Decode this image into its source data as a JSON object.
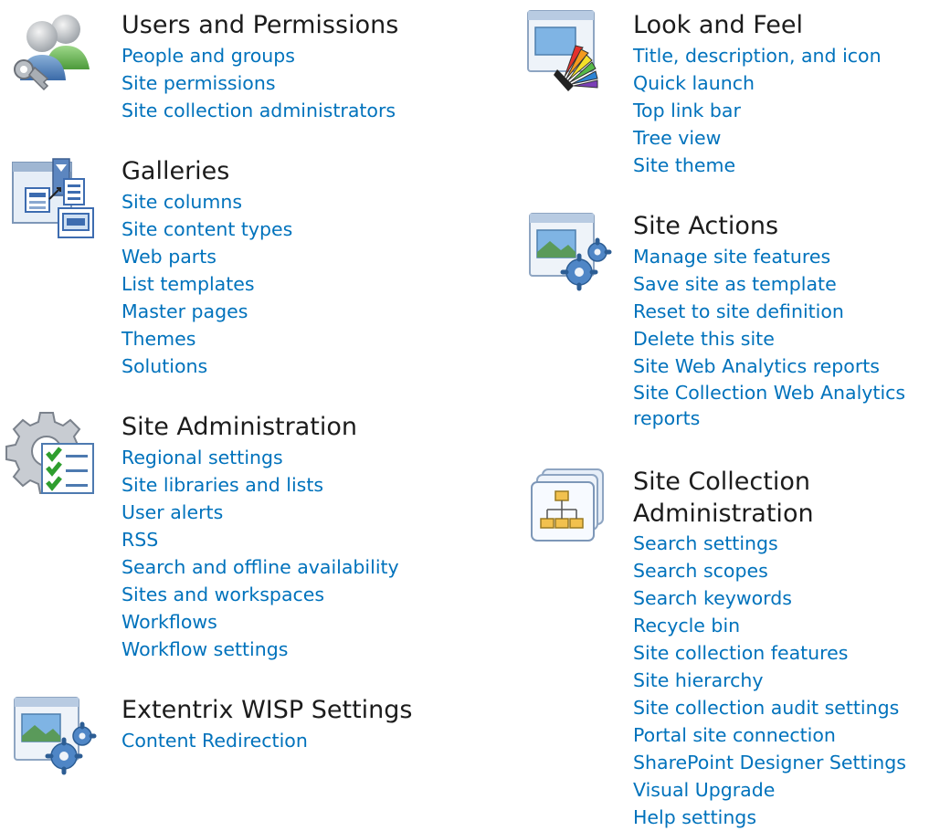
{
  "sections": {
    "users": {
      "icon": "users-permissions-icon",
      "title": "Users and Permissions",
      "links": [
        "People and groups",
        "Site permissions",
        "Site collection administrators"
      ]
    },
    "galleries": {
      "icon": "galleries-icon",
      "title": "Galleries",
      "links": [
        "Site columns",
        "Site content types",
        "Web parts",
        "List templates",
        "Master pages",
        "Themes",
        "Solutions"
      ]
    },
    "site_admin": {
      "icon": "site-administration-icon",
      "title": "Site Administration",
      "links": [
        "Regional settings",
        "Site libraries and lists",
        "User alerts",
        "RSS",
        "Search and offline availability",
        "Sites and workspaces",
        "Workflows",
        "Workflow settings"
      ]
    },
    "extentrix": {
      "icon": "window-gears-icon",
      "title": "Extentrix WISP Settings",
      "links": [
        "Content Redirection"
      ]
    },
    "look_feel": {
      "icon": "look-and-feel-icon",
      "title": "Look and Feel",
      "links": [
        "Title, description, and icon",
        "Quick launch",
        "Top link bar",
        "Tree view",
        "Site theme"
      ]
    },
    "site_actions": {
      "icon": "window-gears-icon",
      "title": "Site Actions",
      "links": [
        "Manage site features",
        "Save site as template",
        "Reset to site definition",
        "Delete this site",
        "Site Web Analytics reports",
        "Site Collection Web Analytics reports"
      ]
    },
    "site_collection": {
      "icon": "site-collection-hierarchy-icon",
      "title": "Site Collection Administration",
      "links": [
        "Search settings",
        "Search scopes",
        "Search keywords",
        "Recycle bin",
        "Site collection features",
        "Site hierarchy",
        "Site collection audit settings",
        "Portal site connection",
        "SharePoint Designer Settings",
        "Visual Upgrade",
        "Help settings"
      ]
    }
  },
  "colors": {
    "link": "#0072bc",
    "heading": "#1c1c1c",
    "background": "#ffffff"
  }
}
